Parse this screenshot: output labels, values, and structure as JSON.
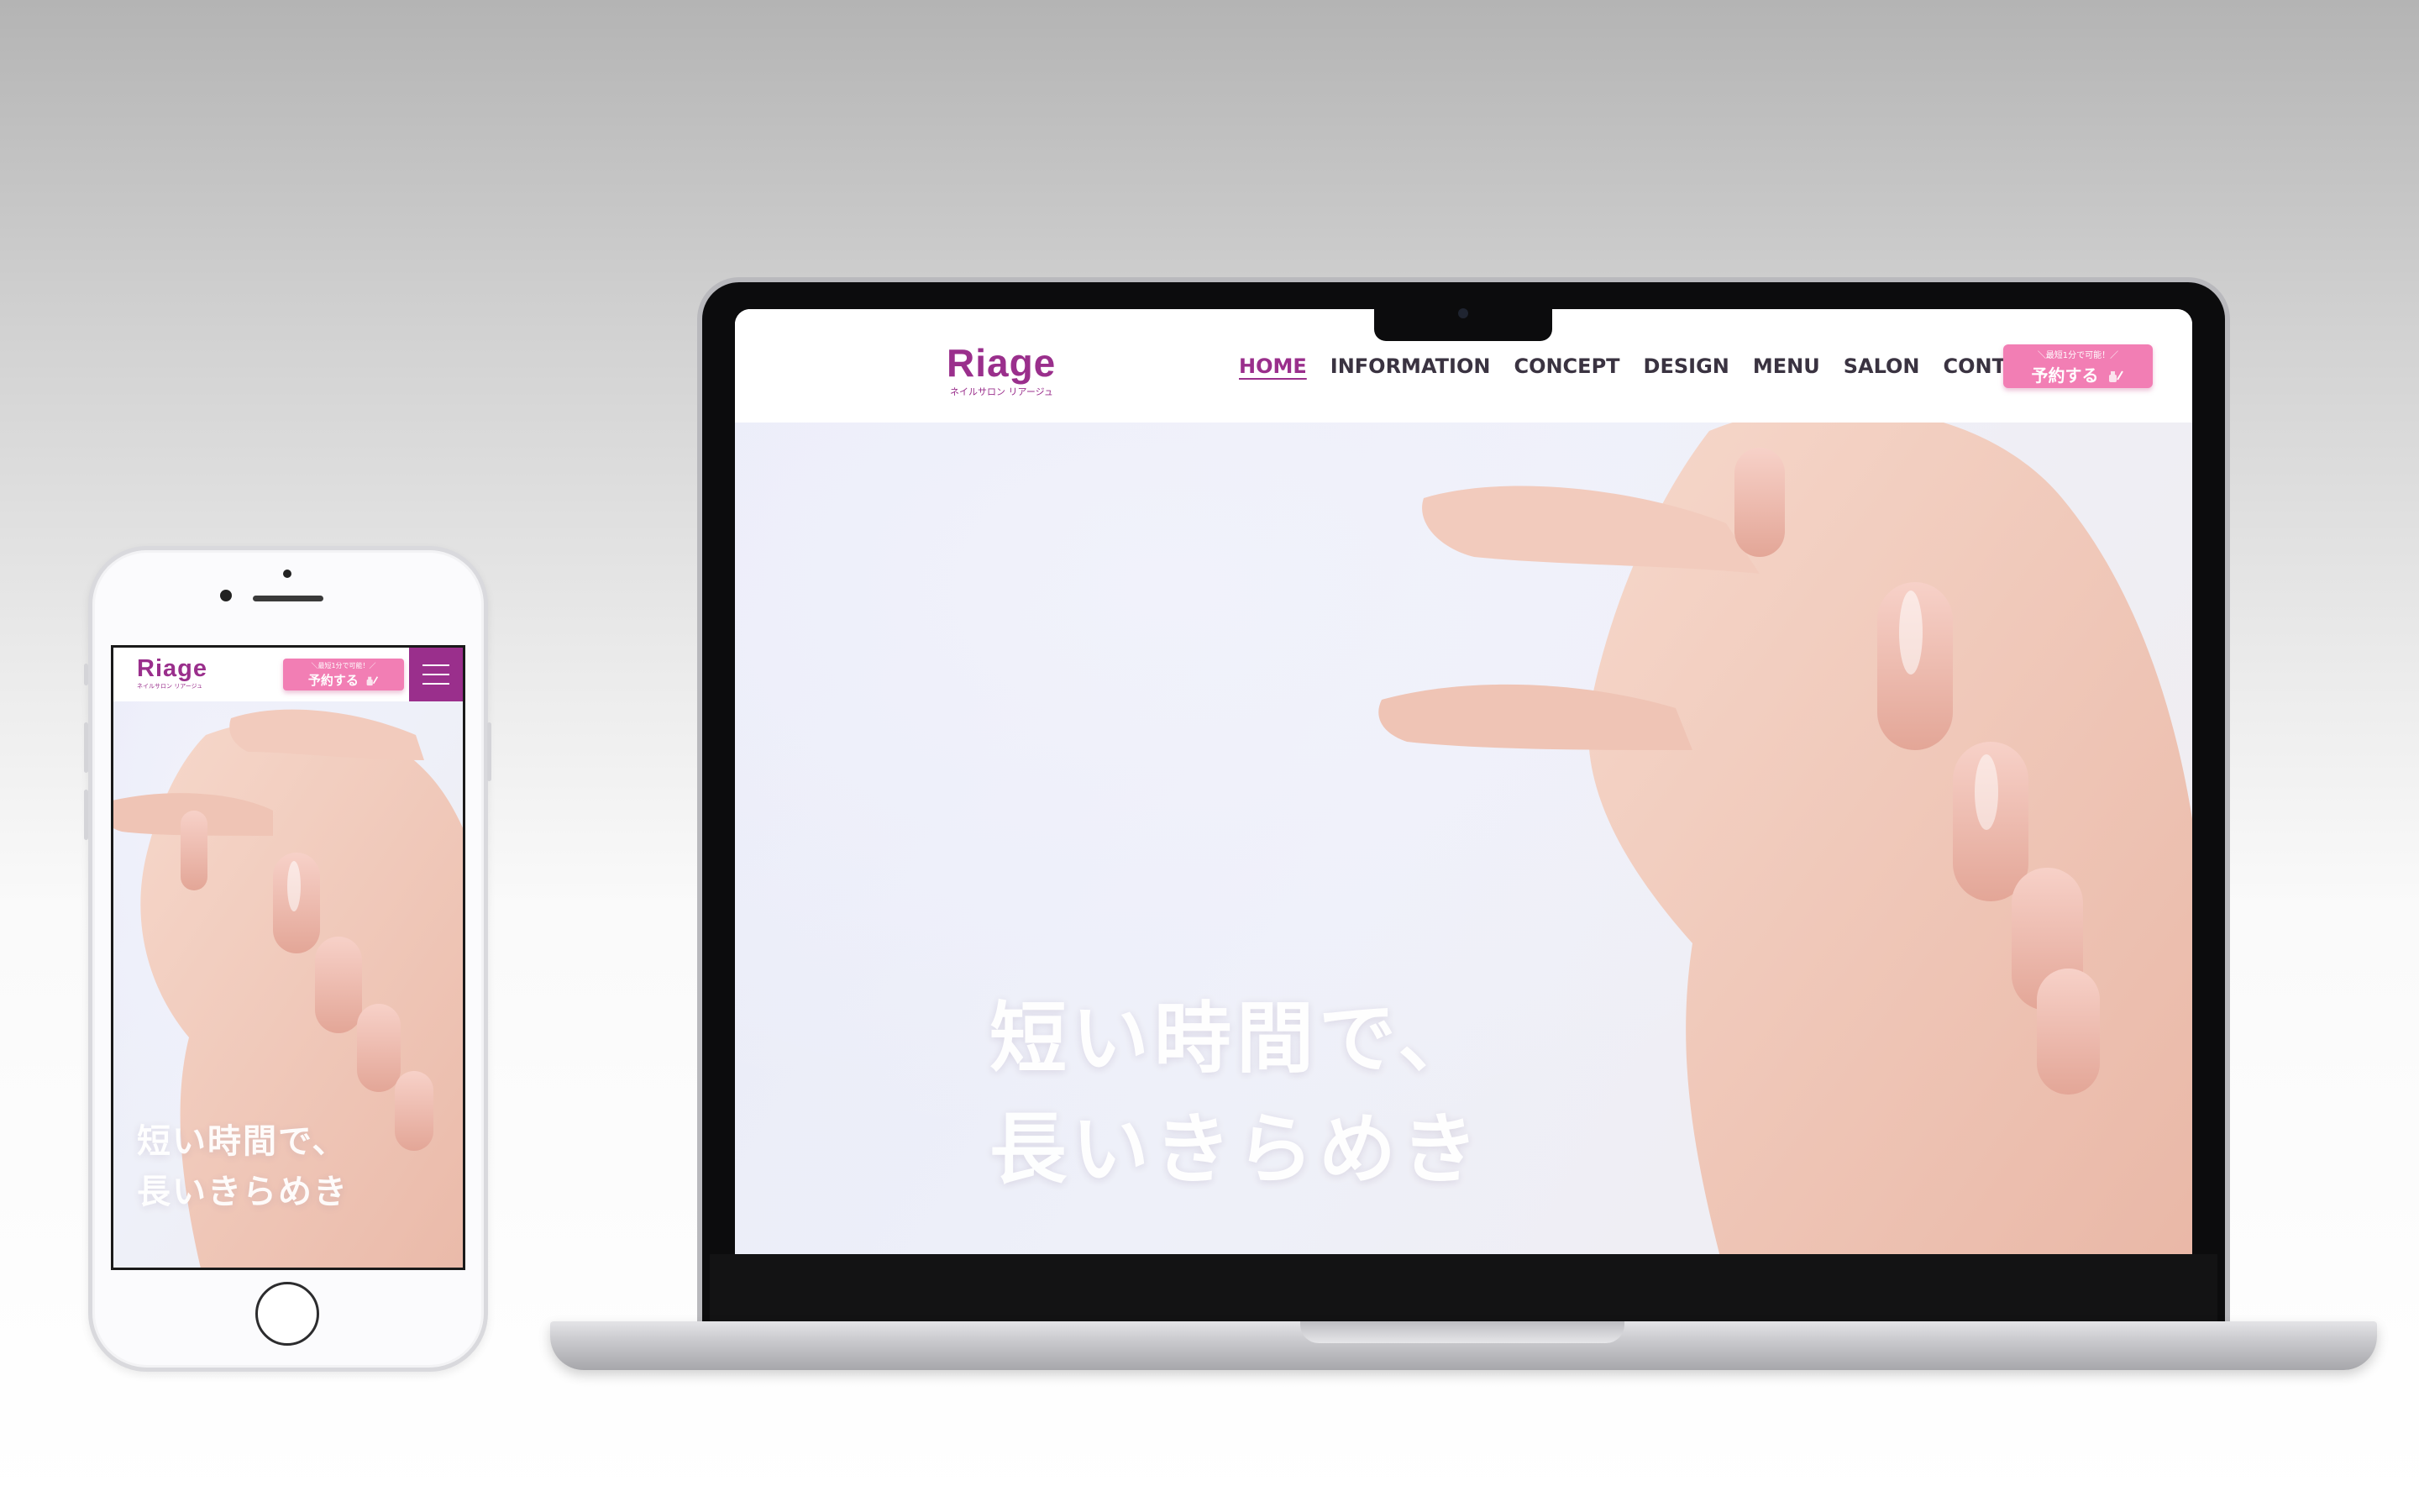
{
  "brand": {
    "name": "Riage",
    "subtitle": "ネイルサロン リアージュ",
    "accent": "#9a2f8c",
    "button_color": "#f27eb4"
  },
  "nav": {
    "items": [
      {
        "label": "HOME",
        "active": true
      },
      {
        "label": "INFORMATION",
        "active": false
      },
      {
        "label": "CONCEPT",
        "active": false
      },
      {
        "label": "DESIGN",
        "active": false
      },
      {
        "label": "MENU",
        "active": false
      },
      {
        "label": "SALON",
        "active": false
      },
      {
        "label": "CONTACT",
        "active": false
      }
    ]
  },
  "reserve": {
    "note": "＼最短1分で可能！／",
    "label": "予約する",
    "icon": "nail-polish-icon"
  },
  "hero": {
    "line1": "短い時間で、",
    "line2": "長いきらめき"
  },
  "mobile": {
    "menu_icon": "hamburger-icon"
  }
}
